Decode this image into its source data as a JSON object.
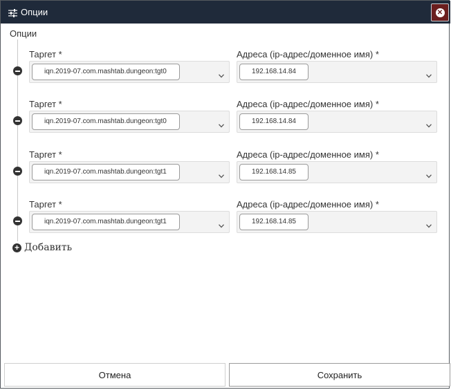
{
  "titlebar": {
    "title": "Опции",
    "icon": "sliders-icon",
    "close_icon": "close-circle-icon"
  },
  "section": {
    "label": "Опции"
  },
  "rows": [
    {
      "target_label": "Таргет *",
      "target_value": "iqn.2019-07.com.mashtab.dungeon:tgt0",
      "address_label": "Адреса (ip-адрес/доменное имя) *",
      "address_value": "192.168.14.84"
    },
    {
      "target_label": "Таргет *",
      "target_value": "iqn.2019-07.com.mashtab.dungeon:tgt0",
      "address_label": "Адреса (ip-адрес/доменное имя) *",
      "address_value": "192.168.14.84"
    },
    {
      "target_label": "Таргет *",
      "target_value": "iqn.2019-07.com.mashtab.dungeon:tgt1",
      "address_label": "Адреса (ip-адрес/доменное имя) *",
      "address_value": "192.168.14.85"
    },
    {
      "target_label": "Таргет *",
      "target_value": "iqn.2019-07.com.mashtab.dungeon:tgt1",
      "address_label": "Адреса (ip-адрес/доменное имя) *",
      "address_value": "192.168.14.85"
    }
  ],
  "add": {
    "label": "Добавить",
    "icon": "plus-circle-icon"
  },
  "footer": {
    "cancel_label": "Отмена",
    "save_label": "Сохранить"
  },
  "colors": {
    "titlebar": "#1f2a3a",
    "close_button": "#6b1e1e"
  }
}
